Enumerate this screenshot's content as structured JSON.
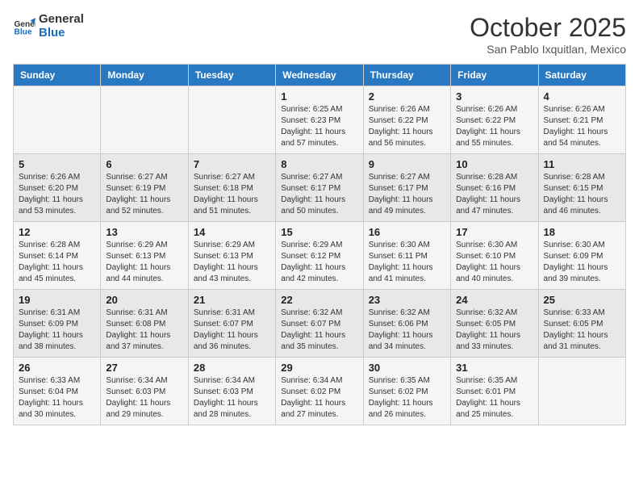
{
  "logo": {
    "line1": "General",
    "line2": "Blue"
  },
  "title": "October 2025",
  "location": "San Pablo Ixquitlan, Mexico",
  "days_of_week": [
    "Sunday",
    "Monday",
    "Tuesday",
    "Wednesday",
    "Thursday",
    "Friday",
    "Saturday"
  ],
  "weeks": [
    [
      {
        "day": "",
        "info": ""
      },
      {
        "day": "",
        "info": ""
      },
      {
        "day": "",
        "info": ""
      },
      {
        "day": "1",
        "info": "Sunrise: 6:25 AM\nSunset: 6:23 PM\nDaylight: 11 hours\nand 57 minutes."
      },
      {
        "day": "2",
        "info": "Sunrise: 6:26 AM\nSunset: 6:22 PM\nDaylight: 11 hours\nand 56 minutes."
      },
      {
        "day": "3",
        "info": "Sunrise: 6:26 AM\nSunset: 6:22 PM\nDaylight: 11 hours\nand 55 minutes."
      },
      {
        "day": "4",
        "info": "Sunrise: 6:26 AM\nSunset: 6:21 PM\nDaylight: 11 hours\nand 54 minutes."
      }
    ],
    [
      {
        "day": "5",
        "info": "Sunrise: 6:26 AM\nSunset: 6:20 PM\nDaylight: 11 hours\nand 53 minutes."
      },
      {
        "day": "6",
        "info": "Sunrise: 6:27 AM\nSunset: 6:19 PM\nDaylight: 11 hours\nand 52 minutes."
      },
      {
        "day": "7",
        "info": "Sunrise: 6:27 AM\nSunset: 6:18 PM\nDaylight: 11 hours\nand 51 minutes."
      },
      {
        "day": "8",
        "info": "Sunrise: 6:27 AM\nSunset: 6:17 PM\nDaylight: 11 hours\nand 50 minutes."
      },
      {
        "day": "9",
        "info": "Sunrise: 6:27 AM\nSunset: 6:17 PM\nDaylight: 11 hours\nand 49 minutes."
      },
      {
        "day": "10",
        "info": "Sunrise: 6:28 AM\nSunset: 6:16 PM\nDaylight: 11 hours\nand 47 minutes."
      },
      {
        "day": "11",
        "info": "Sunrise: 6:28 AM\nSunset: 6:15 PM\nDaylight: 11 hours\nand 46 minutes."
      }
    ],
    [
      {
        "day": "12",
        "info": "Sunrise: 6:28 AM\nSunset: 6:14 PM\nDaylight: 11 hours\nand 45 minutes."
      },
      {
        "day": "13",
        "info": "Sunrise: 6:29 AM\nSunset: 6:13 PM\nDaylight: 11 hours\nand 44 minutes."
      },
      {
        "day": "14",
        "info": "Sunrise: 6:29 AM\nSunset: 6:13 PM\nDaylight: 11 hours\nand 43 minutes."
      },
      {
        "day": "15",
        "info": "Sunrise: 6:29 AM\nSunset: 6:12 PM\nDaylight: 11 hours\nand 42 minutes."
      },
      {
        "day": "16",
        "info": "Sunrise: 6:30 AM\nSunset: 6:11 PM\nDaylight: 11 hours\nand 41 minutes."
      },
      {
        "day": "17",
        "info": "Sunrise: 6:30 AM\nSunset: 6:10 PM\nDaylight: 11 hours\nand 40 minutes."
      },
      {
        "day": "18",
        "info": "Sunrise: 6:30 AM\nSunset: 6:09 PM\nDaylight: 11 hours\nand 39 minutes."
      }
    ],
    [
      {
        "day": "19",
        "info": "Sunrise: 6:31 AM\nSunset: 6:09 PM\nDaylight: 11 hours\nand 38 minutes."
      },
      {
        "day": "20",
        "info": "Sunrise: 6:31 AM\nSunset: 6:08 PM\nDaylight: 11 hours\nand 37 minutes."
      },
      {
        "day": "21",
        "info": "Sunrise: 6:31 AM\nSunset: 6:07 PM\nDaylight: 11 hours\nand 36 minutes."
      },
      {
        "day": "22",
        "info": "Sunrise: 6:32 AM\nSunset: 6:07 PM\nDaylight: 11 hours\nand 35 minutes."
      },
      {
        "day": "23",
        "info": "Sunrise: 6:32 AM\nSunset: 6:06 PM\nDaylight: 11 hours\nand 34 minutes."
      },
      {
        "day": "24",
        "info": "Sunrise: 6:32 AM\nSunset: 6:05 PM\nDaylight: 11 hours\nand 33 minutes."
      },
      {
        "day": "25",
        "info": "Sunrise: 6:33 AM\nSunset: 6:05 PM\nDaylight: 11 hours\nand 31 minutes."
      }
    ],
    [
      {
        "day": "26",
        "info": "Sunrise: 6:33 AM\nSunset: 6:04 PM\nDaylight: 11 hours\nand 30 minutes."
      },
      {
        "day": "27",
        "info": "Sunrise: 6:34 AM\nSunset: 6:03 PM\nDaylight: 11 hours\nand 29 minutes."
      },
      {
        "day": "28",
        "info": "Sunrise: 6:34 AM\nSunset: 6:03 PM\nDaylight: 11 hours\nand 28 minutes."
      },
      {
        "day": "29",
        "info": "Sunrise: 6:34 AM\nSunset: 6:02 PM\nDaylight: 11 hours\nand 27 minutes."
      },
      {
        "day": "30",
        "info": "Sunrise: 6:35 AM\nSunset: 6:02 PM\nDaylight: 11 hours\nand 26 minutes."
      },
      {
        "day": "31",
        "info": "Sunrise: 6:35 AM\nSunset: 6:01 PM\nDaylight: 11 hours\nand 25 minutes."
      },
      {
        "day": "",
        "info": ""
      }
    ]
  ]
}
